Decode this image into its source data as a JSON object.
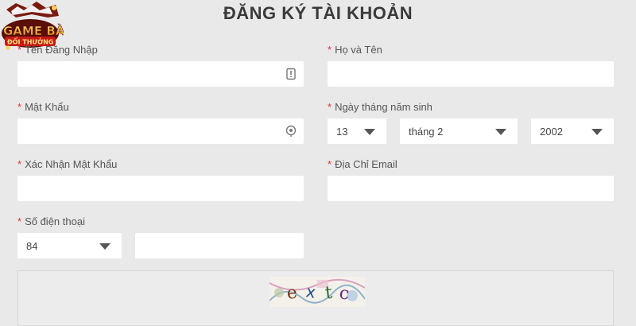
{
  "page": {
    "title": "ĐĂNG KÝ TÀI KHOẢN"
  },
  "logo": {
    "text_top": "GAME BÀI",
    "text_bottom": "ĐỔI THƯỞNG"
  },
  "form": {
    "username": {
      "label": "Tên Đăng Nhập",
      "value": ""
    },
    "fullname": {
      "label": "Họ và Tên",
      "value": ""
    },
    "password": {
      "label": "Mật Khẩu",
      "value": ""
    },
    "birthday": {
      "label": "Ngày tháng năm sinh",
      "day": "13",
      "month": "tháng 2",
      "year": "2002"
    },
    "confirm_password": {
      "label": "Xác Nhận Mật Khẩu",
      "value": ""
    },
    "email": {
      "label": "Địa Chỉ Email",
      "value": ""
    },
    "phone": {
      "label": "Số điện thoại",
      "country_code": "84",
      "value": ""
    },
    "captcha": {
      "text": "extc"
    }
  },
  "colors": {
    "required_star": "#d33333",
    "background": "#e9e9ea",
    "field": "#ffffff"
  },
  "icons": [
    "id-card-icon",
    "eye-icon",
    "chevron-down-icon"
  ]
}
